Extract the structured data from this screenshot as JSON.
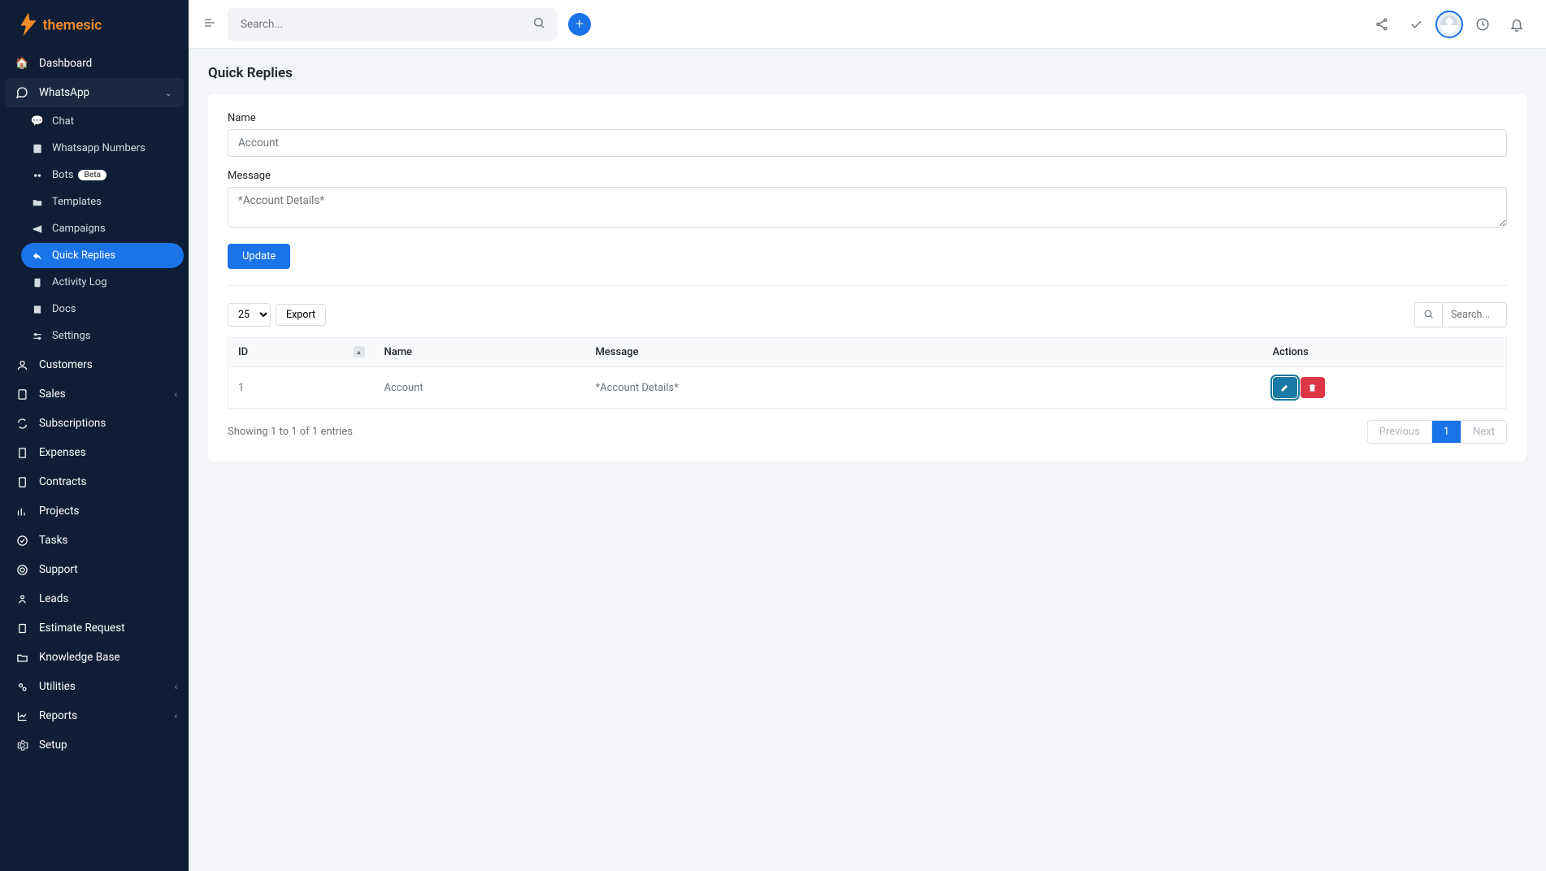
{
  "brand": "themesic",
  "header": {
    "search_placeholder": "Search..."
  },
  "sidebar": {
    "dashboard": "Dashboard",
    "whatsapp": "WhatsApp",
    "whatsapp_sub": {
      "chat": "Chat",
      "numbers": "Whatsapp Numbers",
      "bots": "Bots",
      "bots_badge": "Beta",
      "templates": "Templates",
      "campaigns": "Campaigns",
      "quick_replies": "Quick Replies",
      "activity_log": "Activity Log",
      "docs": "Docs",
      "settings": "Settings"
    },
    "customers": "Customers",
    "sales": "Sales",
    "subscriptions": "Subscriptions",
    "expenses": "Expenses",
    "contracts": "Contracts",
    "projects": "Projects",
    "tasks": "Tasks",
    "support": "Support",
    "leads": "Leads",
    "estimate_request": "Estimate Request",
    "knowledge_base": "Knowledge Base",
    "utilities": "Utilities",
    "reports": "Reports",
    "setup": "Setup"
  },
  "page": {
    "title": "Quick Replies",
    "name_label": "Name",
    "name_value": "Account",
    "message_label": "Message",
    "message_value": "*Account Details*",
    "submit": "Update",
    "page_size": "25",
    "export": "Export",
    "table_search_placeholder": "Search...",
    "cols": {
      "id": "ID",
      "name": "Name",
      "message": "Message",
      "actions": "Actions"
    },
    "rows": [
      {
        "id": "1",
        "name": "Account",
        "message": "*Account Details*"
      }
    ],
    "footer_info": "Showing 1 to 1 of 1 entries",
    "pager": {
      "prev": "Previous",
      "page": "1",
      "next": "Next"
    }
  }
}
